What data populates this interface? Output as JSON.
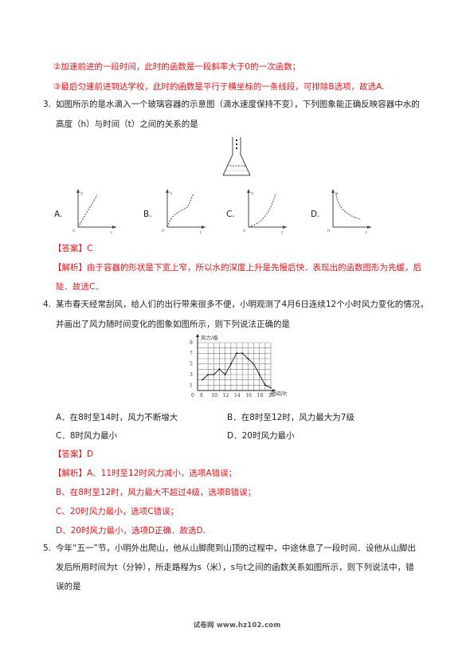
{
  "prev_solution": {
    "line2": "②加速前进的一段时间，此时的函数是一段斜率大于0的一次函数；",
    "line3": "③最后匀速前进到达学校，此时的函数是平行于横坐标的一条线段，可排除B选项，故选A."
  },
  "q3": {
    "number": "3.",
    "stem_line1": "如图所示的是水滴入一个玻璃容器的示意图（滴水速度保持不变），下列图象能正确反映容器中水的",
    "stem_line2": "高度（h）与时间（t）之间的关系的是",
    "options": [
      {
        "label": "A.",
        "curve": "straight line",
        "y_axis": "h",
        "x_axis": "t",
        "origin": "0"
      },
      {
        "label": "B.",
        "curve": "rise-slow-rise",
        "y_axis": "h",
        "x_axis": "t",
        "origin": "0"
      },
      {
        "label": "C.",
        "curve": "slow then fast",
        "y_axis": "h",
        "x_axis": "t",
        "origin": "0"
      },
      {
        "label": "D.",
        "curve": "decreasing",
        "y_axis": "h",
        "x_axis": "t",
        "origin": "0"
      }
    ],
    "answer_tag": "【答案】",
    "answer": "C",
    "analysis_tag": "【解析】",
    "analysis_line1": "由于容器的形状是下宽上窄，所以水的深度上升是先慢后快．表现出的函数图形为先缓，后",
    "analysis_line2": "陡．故选C．"
  },
  "q4": {
    "number": "4.",
    "stem_line1": "某市春天经常刮风，给人们的出行带来很多不便，小明观测了4月6日连续12个小时风力变化的情况，",
    "stem_line2": "并画出了风力随时间变化的图象如图所示，则下列说法正确的是",
    "options": [
      {
        "label": "A．在8时至14时，风力不断增大"
      },
      {
        "label": "B．在8时至12时，风力最大为7级"
      },
      {
        "label": "C．8时风力最小"
      },
      {
        "label": "D．20时风力最小"
      }
    ],
    "answer_tag": "【答案】",
    "answer": "D",
    "analysis_tag": "【解析】",
    "analysis_lines": [
      "A、11时至12时风力减小，选项A错误；",
      "B、在8时至12时，风力最大不超过4级，选项B错误；",
      "C、20时风力最小，选项C错误；",
      "D、20时风力最小，选项D正确．故选D."
    ]
  },
  "q5": {
    "number": "5.",
    "stem_line1": "今年“五一”节，小明外出爬山，他从山脚爬到山顶的过程中，中途休息了一段时间．设他从山脚出",
    "stem_line2": "发后所用时间为t（分钟），所走路程为s（米），s与t之间的函数关系如图所示，则下列说法中，错",
    "stem_line3": "误的是"
  },
  "chart_data": {
    "type": "line",
    "title": "",
    "ylabel": "风力/级",
    "xlabel": "时间/时",
    "x": [
      8,
      9,
      10,
      11,
      12,
      13,
      14,
      15,
      16,
      17,
      18,
      19,
      20
    ],
    "values": [
      2,
      3,
      3,
      4,
      3,
      5,
      7,
      7,
      6,
      5,
      3,
      1,
      0.5
    ],
    "x_ticks": [
      "0",
      "8",
      "10",
      "12",
      "14",
      "16",
      "18",
      "20"
    ],
    "y_ticks": [
      "1",
      "3",
      "5",
      "7",
      "9"
    ],
    "xlim": [
      8,
      20
    ],
    "ylim": [
      0,
      9
    ],
    "grid": true
  },
  "footer": {
    "text": "试卷网  www.hz102.com"
  }
}
